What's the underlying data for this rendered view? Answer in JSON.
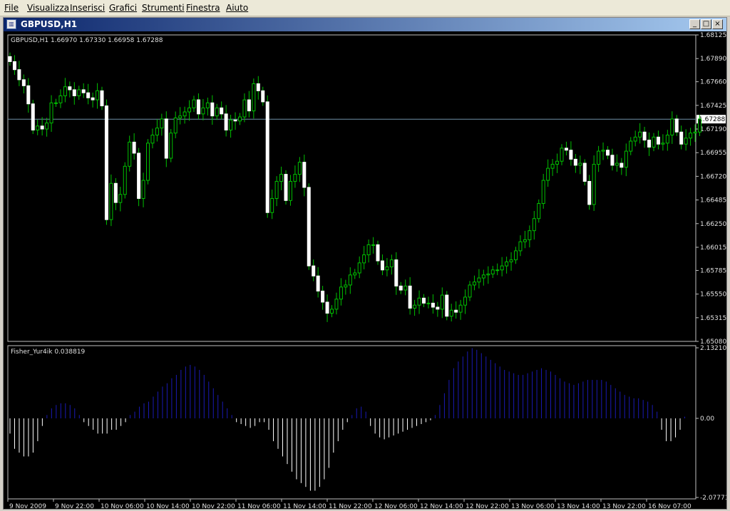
{
  "menu": {
    "items": [
      "File",
      "Visualizza",
      "Inserisci",
      "Grafici",
      "Strumenti",
      "Finestra",
      "Aiuto"
    ]
  },
  "window": {
    "title": "GBPUSD,H1",
    "buttons": {
      "minimize": "_",
      "maximize": "□",
      "close": "×"
    }
  },
  "chart_data": [
    {
      "type": "candlestick",
      "title": "GBPUSD,H1 1.66970 1.67330 1.66958 1.67288",
      "current_price": 1.67288,
      "ylim": [
        1.6508,
        1.68125
      ],
      "y_ticks": [
        "1.68125",
        "1.67890",
        "1.67660",
        "1.67425",
        "1.67190",
        "1.66955",
        "1.66720",
        "1.66485",
        "1.66250",
        "1.66015",
        "1.65785",
        "1.65550",
        "1.65315",
        "1.65080"
      ],
      "closes": [
        1.6786,
        1.6778,
        1.6768,
        1.6762,
        1.6744,
        1.6718,
        1.6722,
        1.6719,
        1.6725,
        1.6745,
        1.6745,
        1.6752,
        1.6761,
        1.6758,
        1.6752,
        1.6758,
        1.6755,
        1.675,
        1.6748,
        1.6757,
        1.6742,
        1.6629,
        1.6665,
        1.6646,
        1.6654,
        1.6682,
        1.6706,
        1.6695,
        1.665,
        1.6668,
        1.6705,
        1.6713,
        1.672,
        1.6729,
        1.669,
        1.6715,
        1.673,
        1.6732,
        1.6736,
        1.674,
        1.6748,
        1.6734,
        1.674,
        1.6745,
        1.6732,
        1.674,
        1.6734,
        1.6718,
        1.6728,
        1.6727,
        1.6731,
        1.6748,
        1.6737,
        1.6764,
        1.6757,
        1.6746,
        1.6636,
        1.665,
        1.6667,
        1.6674,
        1.6648,
        1.6667,
        1.6674,
        1.6686,
        1.6661,
        1.6583,
        1.6573,
        1.6558,
        1.6547,
        1.6536,
        1.654,
        1.655,
        1.6562,
        1.6564,
        1.6574,
        1.6576,
        1.6586,
        1.6594,
        1.6604,
        1.6604,
        1.6588,
        1.6579,
        1.6582,
        1.6589,
        1.6563,
        1.6559,
        1.6563,
        1.6541,
        1.6544,
        1.6551,
        1.6546,
        1.6546,
        1.6542,
        1.654,
        1.6554,
        1.6533,
        1.6539,
        1.6537,
        1.6544,
        1.6552,
        1.6564,
        1.6567,
        1.6571,
        1.6574,
        1.6575,
        1.6579,
        1.6579,
        1.6583,
        1.6587,
        1.6589,
        1.6598,
        1.6607,
        1.6609,
        1.6618,
        1.663,
        1.6645,
        1.6668,
        1.668,
        1.6684,
        1.6687,
        1.67,
        1.6698,
        1.6689,
        1.6683,
        1.6685,
        1.6667,
        1.6644,
        1.6684,
        1.6697,
        1.6698,
        1.6693,
        1.6683,
        1.6685,
        1.6681,
        1.6697,
        1.6707,
        1.6711,
        1.6716,
        1.6708,
        1.6701,
        1.6711,
        1.6704,
        1.6705,
        1.6713,
        1.6729,
        1.6716,
        1.6704,
        1.671,
        1.6715,
        1.6716,
        1.6729
      ]
    },
    {
      "type": "bar",
      "title": "Fisher_Yur4ik 0.038819",
      "ylim": [
        -2.077,
        2.132108
      ],
      "y_ticks": [
        "2.132108",
        "0.00",
        "-2.07771"
      ],
      "x_ticks": [
        "9 Nov 2009",
        "9 Nov 22:00",
        "10 Nov 06:00",
        "10 Nov 14:00",
        "10 Nov 22:00",
        "11 Nov 06:00",
        "11 Nov 14:00",
        "11 Nov 22:00",
        "12 Nov 06:00",
        "12 Nov 14:00",
        "12 Nov 22:00",
        "13 Nov 06:00",
        "13 Nov 14:00",
        "13 Nov 22:00",
        "16 Nov 07:00"
      ],
      "positive_color": "#1a1ab4",
      "negative_color": "#ffffff",
      "values": [
        -0.4,
        -0.8,
        -0.9,
        -1.0,
        -1.0,
        -0.9,
        -0.6,
        -0.2,
        0.1,
        0.3,
        0.4,
        0.45,
        0.45,
        0.4,
        0.3,
        0.1,
        -0.1,
        -0.2,
        -0.3,
        -0.4,
        -0.4,
        -0.4,
        -0.3,
        -0.3,
        -0.2,
        -0.1,
        0.1,
        0.2,
        0.35,
        0.45,
        0.5,
        0.65,
        0.8,
        0.95,
        1.05,
        1.2,
        1.3,
        1.45,
        1.55,
        1.6,
        1.55,
        1.45,
        1.3,
        1.1,
        0.9,
        0.7,
        0.5,
        0.3,
        0.1,
        -0.1,
        -0.15,
        -0.2,
        -0.25,
        -0.2,
        -0.1,
        -0.1,
        -0.3,
        -0.6,
        -0.8,
        -1.0,
        -1.2,
        -1.4,
        -1.6,
        -1.7,
        -1.8,
        -1.9,
        -1.9,
        -1.8,
        -1.6,
        -1.3,
        -0.9,
        -0.6,
        -0.3,
        -0.1,
        0.1,
        0.3,
        0.35,
        0.2,
        -0.2,
        -0.4,
        -0.5,
        -0.55,
        -0.5,
        -0.45,
        -0.4,
        -0.35,
        -0.3,
        -0.25,
        -0.2,
        -0.15,
        -0.1,
        -0.05,
        0.1,
        0.4,
        0.75,
        1.15,
        1.5,
        1.7,
        1.85,
        2.0,
        2.1,
        2.05,
        1.95,
        1.85,
        1.75,
        1.65,
        1.55,
        1.45,
        1.4,
        1.35,
        1.3,
        1.3,
        1.35,
        1.4,
        1.45,
        1.5,
        1.45,
        1.4,
        1.3,
        1.2,
        1.1,
        1.05,
        1.0,
        1.05,
        1.1,
        1.15,
        1.15,
        1.15,
        1.15,
        1.1,
        1.0,
        0.9,
        0.8,
        0.7,
        0.65,
        0.6,
        0.6,
        0.55,
        0.5,
        0.4,
        0.2,
        -0.3,
        -0.6,
        -0.6,
        -0.5,
        -0.3,
        0.05
      ]
    }
  ]
}
